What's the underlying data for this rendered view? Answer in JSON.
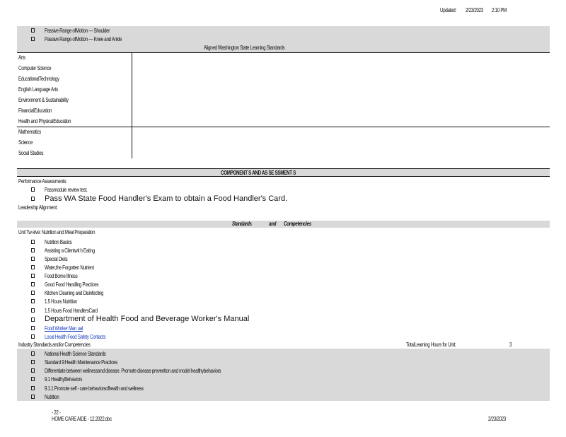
{
  "header": {
    "updated_label": "Updated:",
    "updated_date": "2/23/2023",
    "updated_time": "2:10   PM"
  },
  "top_bullets": [
    "Passive      Range      ofMotion      — Shoulder",
    "Passive      Range      ofMotion      — Knee     and    Ankle"
  ],
  "standards_title": "Aligned       Washington          State      Learning         Standards",
  "subjects": [
    "Arts",
    "Computer          Science",
    "EducationalTechnology",
    "English       Language          Arts",
    "Environment             & Sustainability",
    "FinancialEducation",
    "Health       and     PhysicalEducation",
    "Mathematics",
    "Science",
    "Social Studies"
  ],
  "components_title": "COMPONENT S           AND      AS SE SSMENT S",
  "performance": {
    "label": "Performance            Assessments:",
    "item1": "Passmodule        review      test.",
    "item2": "Pass WA State Food Handler's Exam to obtain a Food Handler's Card."
  },
  "leadership": "Leadership         Alignment:",
  "competencies_title": {
    "a": "Standards",
    "b": "and",
    "c": "Competencies"
  },
  "unit_title": "Unit    Tw  elve:    Nutrition       and    Meal     Preparation",
  "unit_items": [
    "Nutrition       Basics",
    "Assisting      a  Clientwit        h  Eating",
    "Special     Diets",
    "Water,the       Forgotten        Nutrient",
    "Food    Borne     Illness",
    "Good     Food      Handling       Practices",
    "Kitchen      Cleaning       and    Disinfecting",
    "1.5   Hours    Nutrition",
    "1.5   Hours     Food     HandlersCard"
  ],
  "unit_big_item": "Department of Health Food and Beverage Worker's Manual",
  "unit_links": [
    "Food     Worker       Man    ual",
    "Local    Health     Food     Safety     Contacts"
  ],
  "industry": {
    "label": "Industry          Standards        and/or      Competencies",
    "hours_label": "TotalLearning              Hours       for    Unit:",
    "hours_value": "3"
  },
  "industry_items": [
    "National     Health     Science      Standards",
    "Standard      9:Health      Maintenance         Practices",
    "Differentiate        between       wellnessand         disease.      Promote       disease       prevention         and    model     healthybehaviors",
    "9.1   HealthyBehaviors",
    "9.1.1    Promote      self   - care    behaviorsofhealth             and    wellness",
    "Nutrition"
  ],
  "footer": {
    "page": "- 22  -",
    "doc": "HOME    CARE     AIDE    - 12.2022.doc",
    "date": "2/23/2023"
  }
}
